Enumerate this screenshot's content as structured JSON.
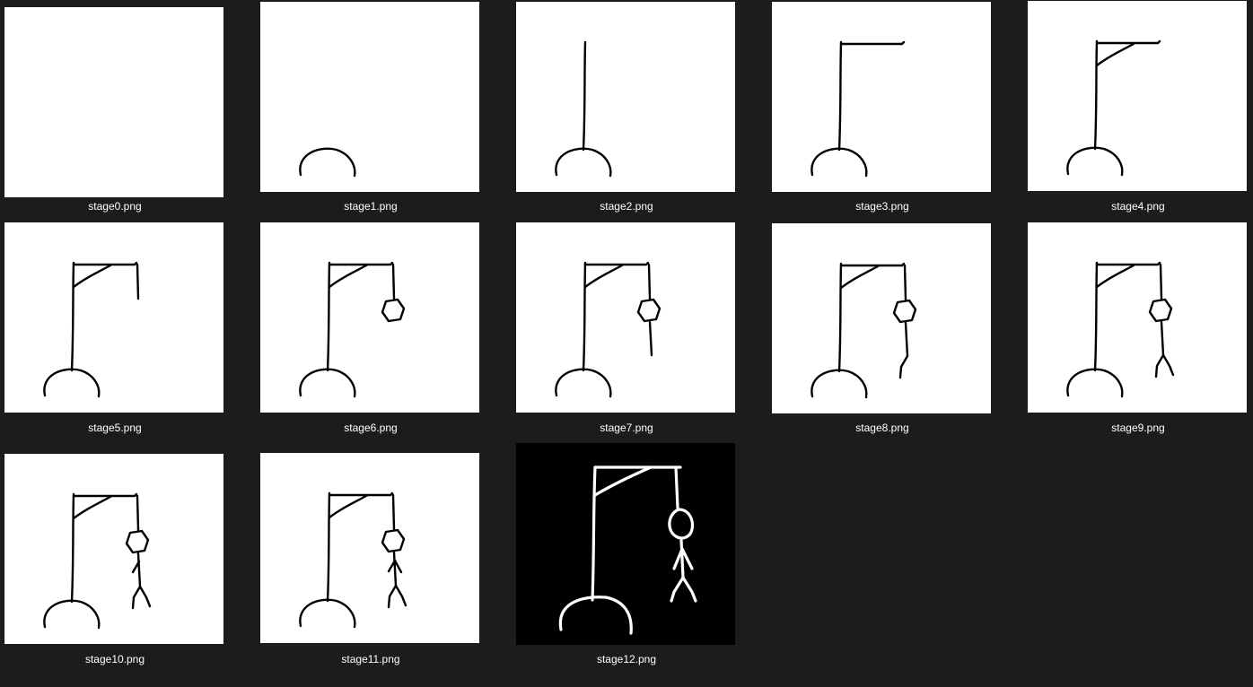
{
  "files": [
    {
      "name": "stage0.png",
      "stage": 0,
      "theme": "light"
    },
    {
      "name": "stage1.png",
      "stage": 1,
      "theme": "light"
    },
    {
      "name": "stage2.png",
      "stage": 2,
      "theme": "light"
    },
    {
      "name": "stage3.png",
      "stage": 3,
      "theme": "light"
    },
    {
      "name": "stage4.png",
      "stage": 4,
      "theme": "light"
    },
    {
      "name": "stage5.png",
      "stage": 5,
      "theme": "light"
    },
    {
      "name": "stage6.png",
      "stage": 6,
      "theme": "light"
    },
    {
      "name": "stage7.png",
      "stage": 7,
      "theme": "light"
    },
    {
      "name": "stage8.png",
      "stage": 8,
      "theme": "light"
    },
    {
      "name": "stage9.png",
      "stage": 9,
      "theme": "light"
    },
    {
      "name": "stage10.png",
      "stage": 10,
      "theme": "light"
    },
    {
      "name": "stage11.png",
      "stage": 11,
      "theme": "light"
    },
    {
      "name": "stage12.png",
      "stage": 12,
      "theme": "dark"
    }
  ],
  "colors": {
    "window_bg": "#1c1c1c",
    "caption_text": "#ffffff",
    "light_bg": "#ffffff",
    "light_ink": "#000000",
    "dark_bg": "#000000",
    "dark_ink": "#ffffff"
  }
}
